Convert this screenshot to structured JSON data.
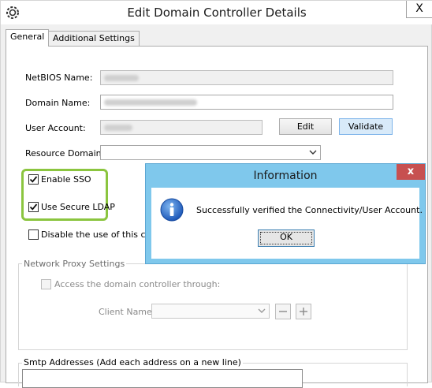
{
  "window": {
    "title": "Edit Domain Controller Details",
    "close_glyph": "X"
  },
  "tabs": [
    {
      "label": "General",
      "active": true
    },
    {
      "label": "Additional Settings",
      "active": false
    }
  ],
  "general": {
    "netbios_label": "NetBIOS Name:",
    "netbios_value": "",
    "domain_label": "Domain Name:",
    "domain_value": "",
    "account_label": "User Account:",
    "account_value": "",
    "edit_label": "Edit",
    "validate_label": "Validate",
    "resource_domain_label": "Resource Domain",
    "resource_domain_value": "",
    "enable_sso_label": "Enable SSO",
    "enable_sso_checked": true,
    "secure_ldap_label": "Use Secure LDAP",
    "secure_ldap_checked": true,
    "disable_label": "Disable the use of this cont",
    "disable_checked": false
  },
  "proxy": {
    "group_title": "Network Proxy Settings",
    "access_label": "Access the domain controller through:",
    "client_name_label": "Client Name:",
    "client_name_value": "",
    "remove_glyph": "—",
    "add_glyph": "+"
  },
  "smtp": {
    "group_title": "Smtp Addresses (Add each address on a new line)"
  },
  "dialog": {
    "title": "Information",
    "close_glyph": "x",
    "message": "Successfully verified the Connectivity/User Account.",
    "ok_label": "OK",
    "icon": "info-icon"
  },
  "colors": {
    "dialog_frame": "#7fc8ec",
    "dialog_close": "#c75050",
    "highlight": "#8bc53f",
    "validate_button": "#d8eaf9"
  }
}
